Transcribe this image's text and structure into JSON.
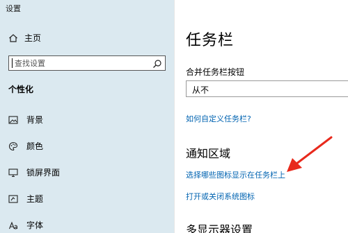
{
  "window": {
    "title": "设置"
  },
  "sidebar": {
    "home_label": "主页",
    "search": {
      "placeholder": "查找设置"
    },
    "section_title": "个性化",
    "items": [
      {
        "label": "背景",
        "icon": "image-icon"
      },
      {
        "label": "颜色",
        "icon": "palette-icon"
      },
      {
        "label": "锁屏界面",
        "icon": "lock-screen-icon"
      },
      {
        "label": "主题",
        "icon": "theme-icon"
      },
      {
        "label": "字体",
        "icon": "font-icon"
      }
    ]
  },
  "main": {
    "title": "任务栏",
    "combine_label": "合并任务栏按钮",
    "combine_value": "从不",
    "customize_link": "如何自定义任务栏?",
    "notification_heading": "通知区域",
    "select_icons_link": "选择哪些图标显示在任务栏上",
    "system_icons_link": "打开或关闭系统图标",
    "multi_display_heading": "多显示器设置"
  },
  "colors": {
    "link": "#0063b1",
    "sidebar_bg": "#dbe9f0",
    "arrow": "#e8291c"
  }
}
